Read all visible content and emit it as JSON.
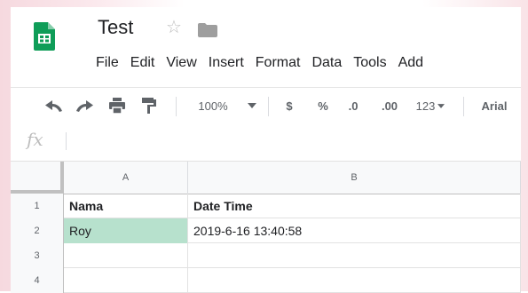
{
  "app": {
    "title": "Test",
    "brand_color": "#0f9d58",
    "icons": [
      "sheets-logo-icon",
      "star-icon",
      "folder-icon"
    ]
  },
  "menu": [
    "File",
    "Edit",
    "View",
    "Insert",
    "Format",
    "Data",
    "Tools",
    "Add"
  ],
  "toolbar": {
    "zoom": "100%",
    "currency": "$",
    "percent": "%",
    "decrease_decimal": ".0",
    "increase_decimal": ".00",
    "more_formats": "123",
    "font": "Arial",
    "icons": [
      "undo-icon",
      "redo-icon",
      "print-icon",
      "paint-format-icon",
      "chevron-down-icon"
    ]
  },
  "formula_bar": {
    "fx_label": "fx",
    "value": ""
  },
  "grid": {
    "columns": [
      "A",
      "B"
    ],
    "rows": [
      {
        "num": "1",
        "cells": [
          "Nama",
          "Date Time"
        ]
      },
      {
        "num": "2",
        "cells": [
          "Roy",
          "2019-6-16 13:40:58"
        ]
      },
      {
        "num": "3",
        "cells": [
          "",
          ""
        ]
      },
      {
        "num": "4",
        "cells": [
          "",
          ""
        ]
      }
    ],
    "selection_color": "#b7e1cd"
  }
}
